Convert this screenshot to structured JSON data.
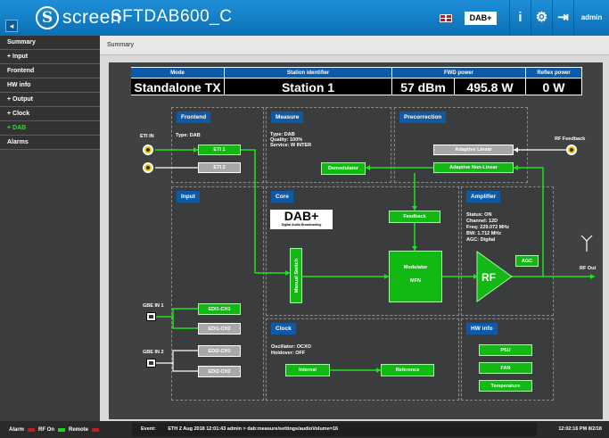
{
  "header": {
    "logo_glyph": "S",
    "logo_text": "screen",
    "device_name": "SFTDAB600_C",
    "dab_badge": "DAB+",
    "info_icon": "i",
    "settings_icon": "⚙",
    "logout_icon": "⇥",
    "user": "admin",
    "accent": "#1279c4"
  },
  "sidebar": {
    "items": [
      {
        "label": "Summary",
        "active": false
      },
      {
        "label": "+ Input",
        "active": false
      },
      {
        "label": "Frontend",
        "active": false
      },
      {
        "label": "HW info",
        "active": false
      },
      {
        "label": "+ Output",
        "active": false
      },
      {
        "label": "+ Clock",
        "active": false
      },
      {
        "label": "+ DAB",
        "active": true
      },
      {
        "label": "Alarms",
        "active": false
      }
    ]
  },
  "breadcrumb": "Summary",
  "summary": {
    "headers": [
      "Mode",
      "Station identifier",
      "FWD power",
      "Reflex power"
    ],
    "mode": "Standalone TX",
    "station": "Station 1",
    "fwd_dbm": "57 dBm",
    "fwd_w": "495.8 W",
    "reflex": "0 W"
  },
  "diagram": {
    "frontend": {
      "title": "Frontend",
      "type": "Type: DAB",
      "eti1": "ETI 1",
      "eti2": "ETI 2",
      "eti_in": "ETI IN"
    },
    "measure": {
      "title": "Measure",
      "lines": [
        "Type: DAB",
        "Quality: 100%",
        "Service: W INTER"
      ],
      "demodulator": "Demodulator"
    },
    "precorrection": {
      "title": "Precorrection",
      "adaptive_linear": "Adaptive Linear",
      "adaptive_nonlinear": "Adaptive Non-Linear",
      "rf_feedback": "RF Feedback"
    },
    "input": {
      "title": "Input",
      "gbe1": "GBE IN 1",
      "gbe2": "GBE IN 2",
      "e1c1": "EDI1-CH1",
      "e1c2": "EDI1-CH2",
      "e2c1": "EDI2-CH1",
      "e2c2": "EDI2-CH2"
    },
    "core": {
      "title": "Core",
      "dab_logo": "DAB+",
      "dab_sub": "Digital Audio Broadcasting",
      "feedback": "Feedback",
      "manual_switch": "Manual Switch",
      "modulator": "Modulator",
      "mfn": "MFN"
    },
    "amplifier": {
      "title": "Amplifier",
      "lines": [
        "Status: ON",
        "Channel: 12D",
        "Freq: 229.072 MHz",
        "BW: 1.712 MHz",
        "AGC: Digital"
      ],
      "agc": "AGC",
      "rf": "RF",
      "rf_out": "RF Out"
    },
    "clock": {
      "title": "Clock",
      "lines": [
        "Oscillator: OCXO",
        "Holdover: OFF"
      ],
      "internal": "Internal",
      "reference": "Reference"
    },
    "hwinfo": {
      "title": "HW info",
      "psu": "PSU",
      "fan": "FAN",
      "temperature": "Temperature"
    },
    "wire_color": "#19e619"
  },
  "footer": {
    "alarm": "Alarm",
    "rf_on": "RF On",
    "remote": "Remote",
    "event_label": "Event:",
    "event_text": "ETH 2 Aug 2018 12:01:43 admin > dab:measure/settings/audioVolume=16",
    "time": "12:02:16 PM 8/2/18"
  }
}
